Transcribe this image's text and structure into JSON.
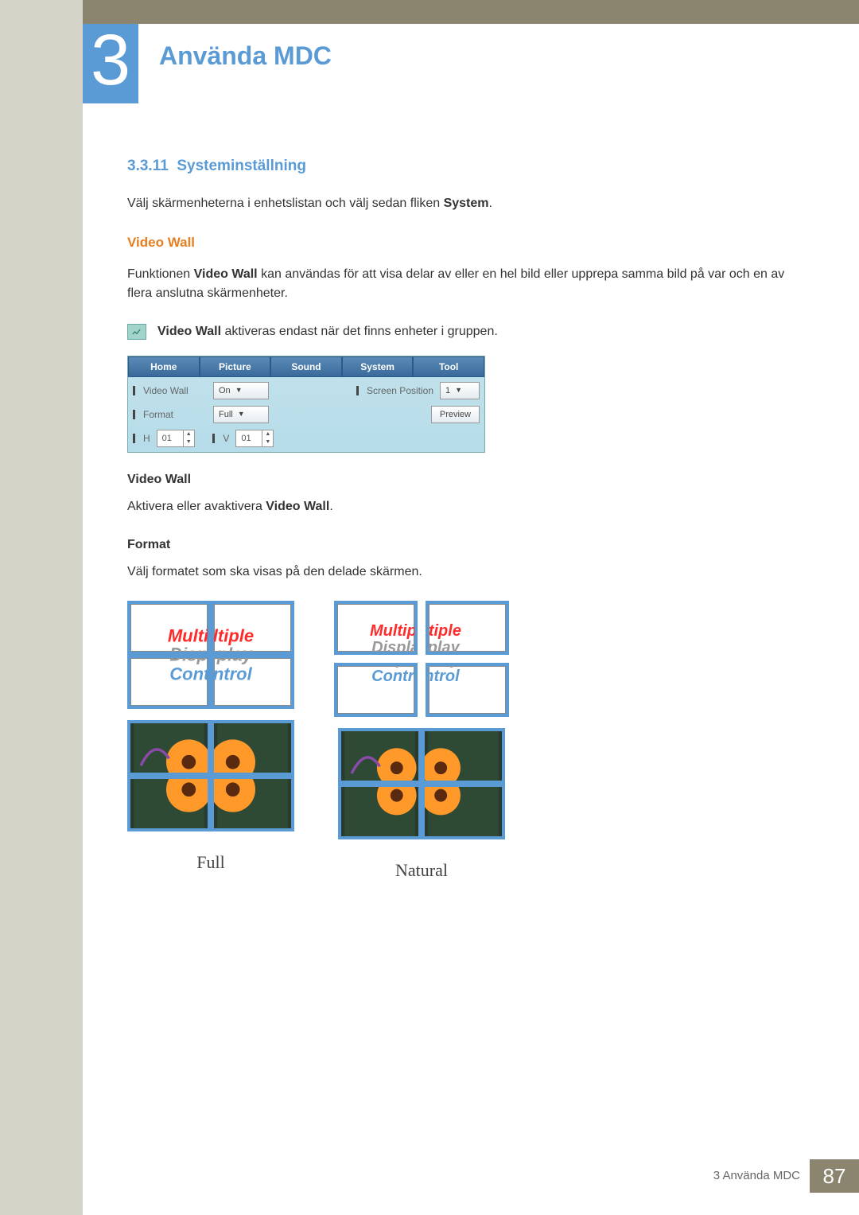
{
  "header": {
    "chapter_number": "3",
    "chapter_title": "Använda MDC"
  },
  "section": {
    "number": "3.3.11",
    "title": "Systeminställning",
    "intro_pre": "Välj skärmenheterna i enhetslistan och välj sedan fliken ",
    "intro_bold": "System",
    "intro_post": "."
  },
  "videowall": {
    "heading": "Video Wall",
    "desc_pre": "Funktionen ",
    "desc_bold": "Video Wall",
    "desc_post": " kan användas för att visa delar av eller en hel bild eller upprepa samma bild på var och en av flera anslutna skärmenheter.",
    "note_bold": "Video Wall",
    "note_post": " aktiveras endast när det finns enheter i gruppen."
  },
  "ui": {
    "tabs": [
      "Home",
      "Picture",
      "Sound",
      "System",
      "Tool"
    ],
    "left": {
      "video_wall_label": "Video Wall",
      "video_wall_value": "On",
      "format_label": "Format",
      "format_value": "Full",
      "h_label": "H",
      "h_value": "01",
      "v_label": "V",
      "v_value": "01"
    },
    "right": {
      "screen_position_label": "Screen Position",
      "screen_position_value": "1",
      "preview_button": "Preview"
    }
  },
  "subs": {
    "vw_head": "Video Wall",
    "vw_text_pre": "Aktivera eller avaktivera ",
    "vw_text_bold": "Video Wall",
    "vw_text_post": ".",
    "format_head": "Format",
    "format_text": "Välj formatet som ska visas på den delade skärmen."
  },
  "diagram_text": {
    "line1": "Multiple",
    "line2": "Display",
    "line3": "Control"
  },
  "captions": {
    "full": "Full",
    "natural": "Natural"
  },
  "footer": {
    "label": "3 Använda MDC",
    "page": "87"
  }
}
